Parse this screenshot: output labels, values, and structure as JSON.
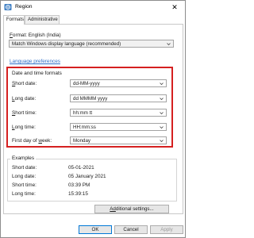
{
  "window": {
    "title": "Region",
    "close_symbol": "✕"
  },
  "tabs": [
    {
      "label": "Formats",
      "active": true
    },
    {
      "label": "Administrative",
      "active": false
    }
  ],
  "format": {
    "label_prefix": "F",
    "label_rest": "ormat: English (India)",
    "selected": "Match Windows display language (recommended)"
  },
  "language_preferences_link": "Language preferences",
  "date_time_formats": {
    "title": "Date and time formats",
    "rows": [
      {
        "label_u": "S",
        "label_rest": "hort date:",
        "value": "dd-MM-yyyy"
      },
      {
        "label_u": "L",
        "label_rest": "ong date:",
        "value": "dd MMMM yyyy"
      },
      {
        "label_u": "S",
        "label_rest": "hort time:",
        "value": "hh:mm tt"
      },
      {
        "label_u": "L",
        "label_rest": "ong time:",
        "value": "HH:mm:ss"
      },
      {
        "label_pre": "First day of ",
        "label_u": "w",
        "label_rest": "eek:",
        "value": "Monday"
      }
    ]
  },
  "examples": {
    "title": "Examples",
    "rows": [
      {
        "label": "Short date:",
        "value": "05-01-2021"
      },
      {
        "label": "Long date:",
        "value": "05 January 2021"
      },
      {
        "label": "Short time:",
        "value": "03:39 PM"
      },
      {
        "label": "Long time:",
        "value": "15:39:15"
      }
    ]
  },
  "buttons": {
    "additional_settings_u": "Ad",
    "additional_settings_rest": "ditional settings...",
    "ok": "OK",
    "cancel": "Cancel",
    "apply": "Apply"
  },
  "colors": {
    "highlight": "#d52020",
    "link": "#2e6fc8",
    "focus": "#0078d7"
  }
}
